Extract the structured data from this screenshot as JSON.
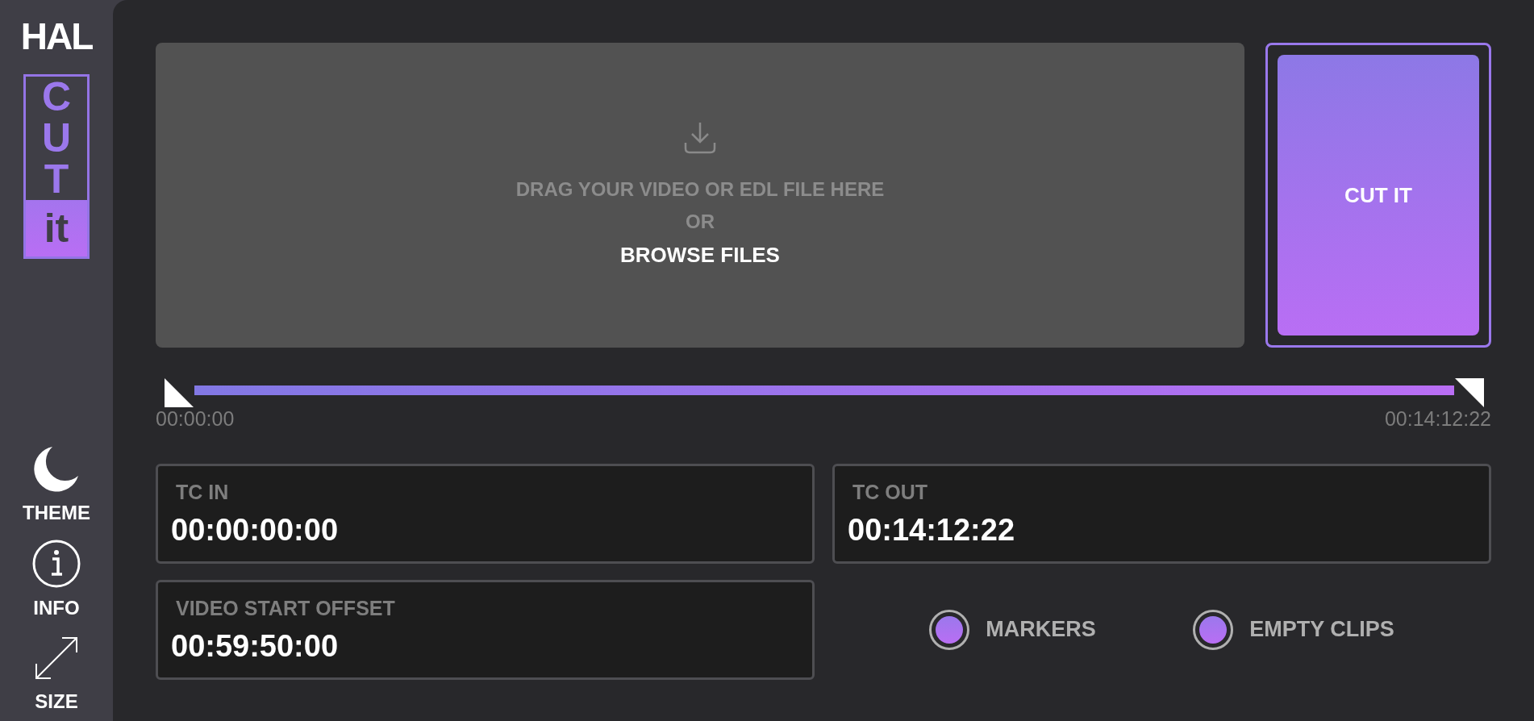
{
  "sidebar": {
    "logo": "HAL",
    "app_badge": {
      "letters": [
        "C",
        "U",
        "T"
      ],
      "footer": "it"
    },
    "items": [
      {
        "kind": "theme",
        "label": "THEME"
      },
      {
        "kind": "info",
        "label": "INFO"
      },
      {
        "kind": "size",
        "label": "SIZE"
      }
    ]
  },
  "drop_zone": {
    "hint": "DRAG YOUR VIDEO OR EDL FILE HERE",
    "or": "OR",
    "browse": "BROWSE FILES"
  },
  "cut_button": {
    "label": "CUT IT"
  },
  "timeline": {
    "start": "00:00:00",
    "end": "00:14:12:22"
  },
  "fields": [
    {
      "label": "TC IN",
      "value": "00:00:00:00"
    },
    {
      "label": "TC OUT",
      "value": "00:14:12:22"
    },
    {
      "label": "VIDEO START OFFSET",
      "value": "00:59:50:00"
    }
  ],
  "options": [
    {
      "label": "MARKERS",
      "checked": true
    },
    {
      "label": "EMPTY CLIPS",
      "checked": true
    }
  ]
}
